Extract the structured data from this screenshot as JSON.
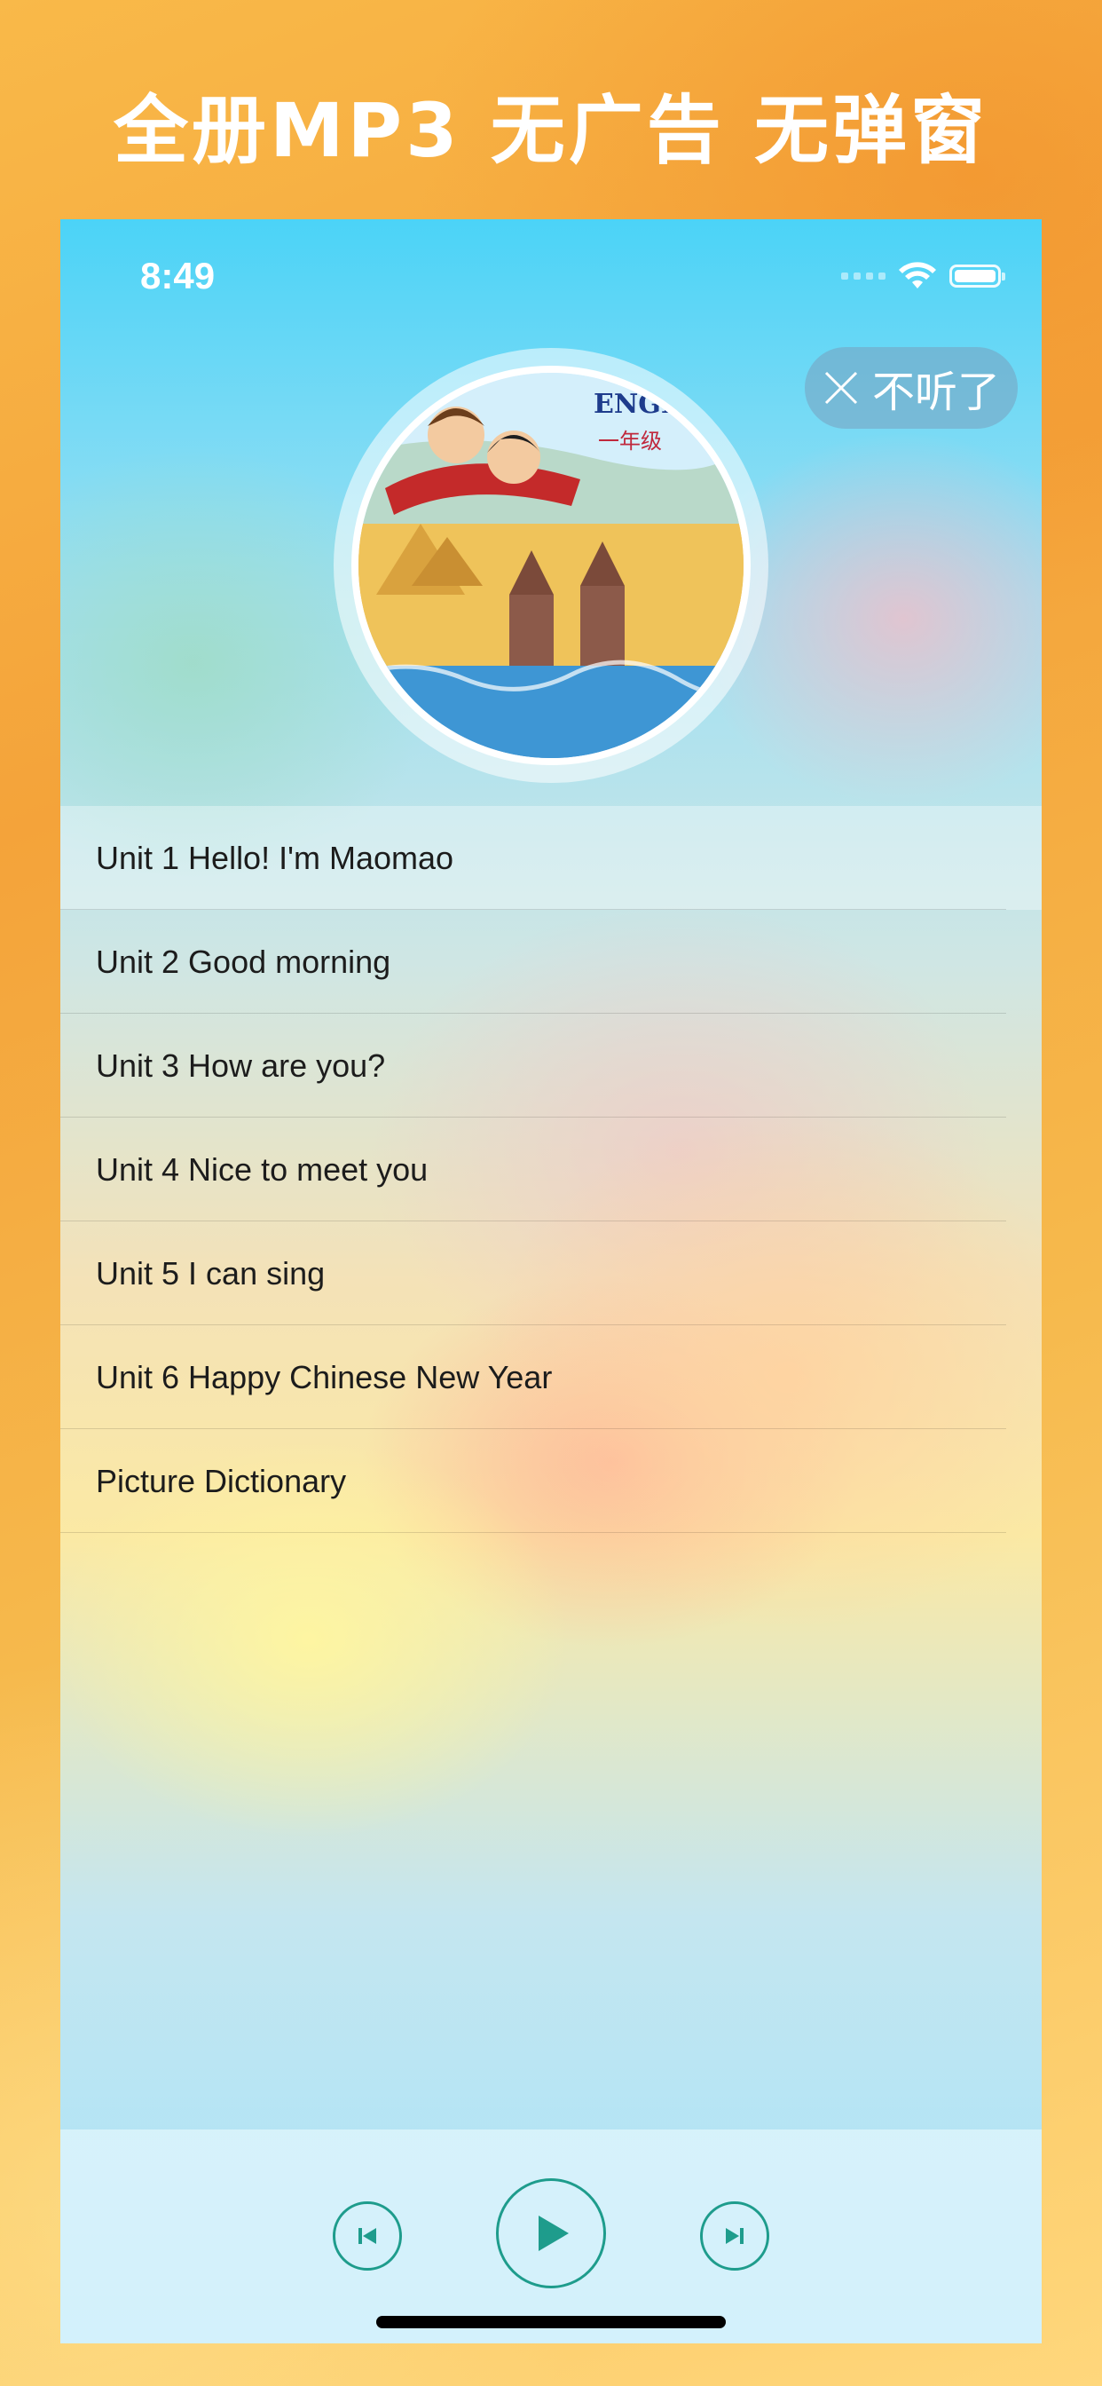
{
  "headline": "全册MP3 无广告 无弹窗",
  "status_bar": {
    "time": "8:49"
  },
  "close_button": {
    "label": "不听了"
  },
  "tracks": [
    "Unit 1  Hello! I'm Maomao",
    "Unit 2  Good morning",
    "Unit 3 How are you?",
    "Unit 4  Nice to meet you",
    "Unit 5  I can sing",
    "Unit 6  Happy Chinese New Year",
    "Picture Dictionary"
  ],
  "cover": {
    "title_text": "ENGLI",
    "grade_text": "一年级",
    "icon": "book-cover-image"
  },
  "player": {
    "prev_icon": "skip-previous-icon",
    "play_icon": "play-icon",
    "next_icon": "skip-next-icon"
  },
  "colors": {
    "accent": "#1e9c8c",
    "background": "#f4a33a"
  }
}
